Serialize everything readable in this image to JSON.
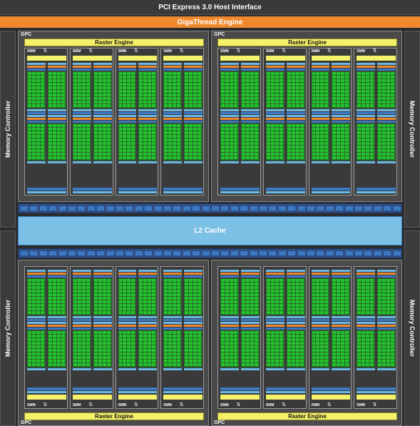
{
  "header": {
    "pcie": "PCI Express 3.0 Host Interface",
    "gigathread": "GigaThread Engine"
  },
  "memory_controller": "Memory Controller",
  "l2_cache": "L2 Cache",
  "gpc": {
    "label": "GPC",
    "raster_engine": "Raster Engine",
    "smm_label": "SMM"
  },
  "colors": {
    "orange": "#f0892d",
    "yellow": "#f5f26a",
    "light_blue": "#6cb8e4",
    "dark_blue": "#3c79c4",
    "green": "#21c62d",
    "l2": "#7cc0e6"
  }
}
